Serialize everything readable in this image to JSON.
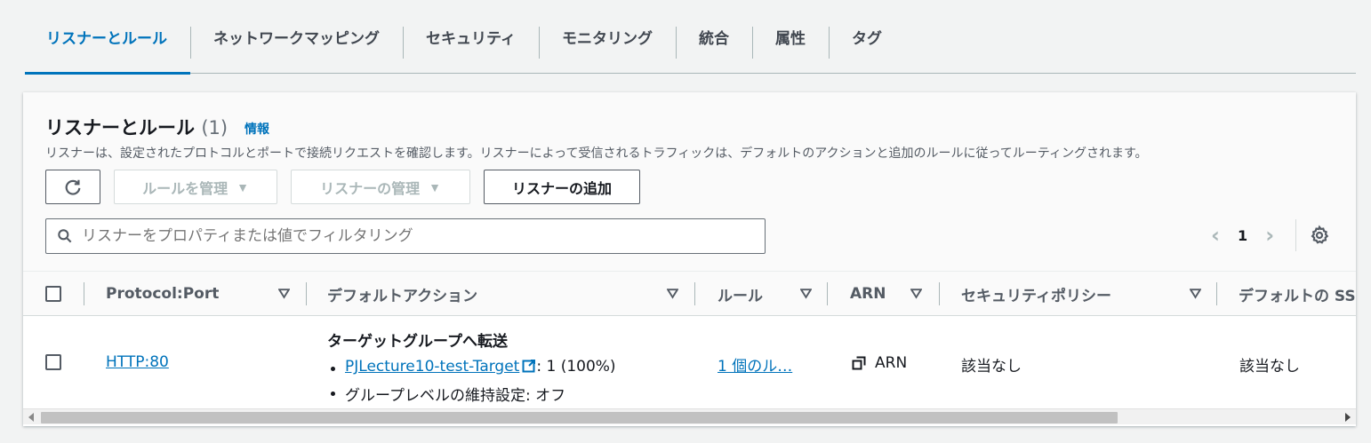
{
  "tabs": [
    {
      "label": "リスナーとルール",
      "active": true
    },
    {
      "label": "ネットワークマッピング"
    },
    {
      "label": "セキュリティ"
    },
    {
      "label": "モニタリング"
    },
    {
      "label": "統合"
    },
    {
      "label": "属性"
    },
    {
      "label": "タグ"
    }
  ],
  "panel": {
    "title": "リスナーとルール",
    "count": "(1)",
    "info": "情報",
    "description": "リスナーは、設定されたプロトコルとポートで接続リクエストを確認します。リスナーによって受信されるトラフィックは、デフォルトのアクションと追加のルールに従ってルーティングされます。",
    "buttons": {
      "manage_rules": "ルールを管理",
      "manage_listeners": "リスナーの管理",
      "add_listener": "リスナーの追加"
    },
    "search": {
      "placeholder": "リスナーをプロパティまたは値でフィルタリング"
    },
    "pagination": {
      "current_page": "1"
    }
  },
  "table": {
    "columns": [
      "Protocol:Port",
      "デフォルトアクション",
      "ルール",
      "ARN",
      "セキュリティポリシー",
      "デフォルトの SS"
    ],
    "rows": [
      {
        "protocol_port": "HTTP:80",
        "action_title": "ターゲットグループへ転送",
        "target_group": "PJLecture10-test-Target",
        "target_weight": ": 1 (100%)",
        "stickiness": "グループレベルの維持設定: オフ",
        "rules": "1 個のル…",
        "arn": "ARN",
        "security_policy": "該当なし",
        "default_ssl": "該当なし"
      }
    ]
  },
  "colors": {
    "accent": "#0073bb",
    "text": "#16191f",
    "muted": "#545b64"
  }
}
